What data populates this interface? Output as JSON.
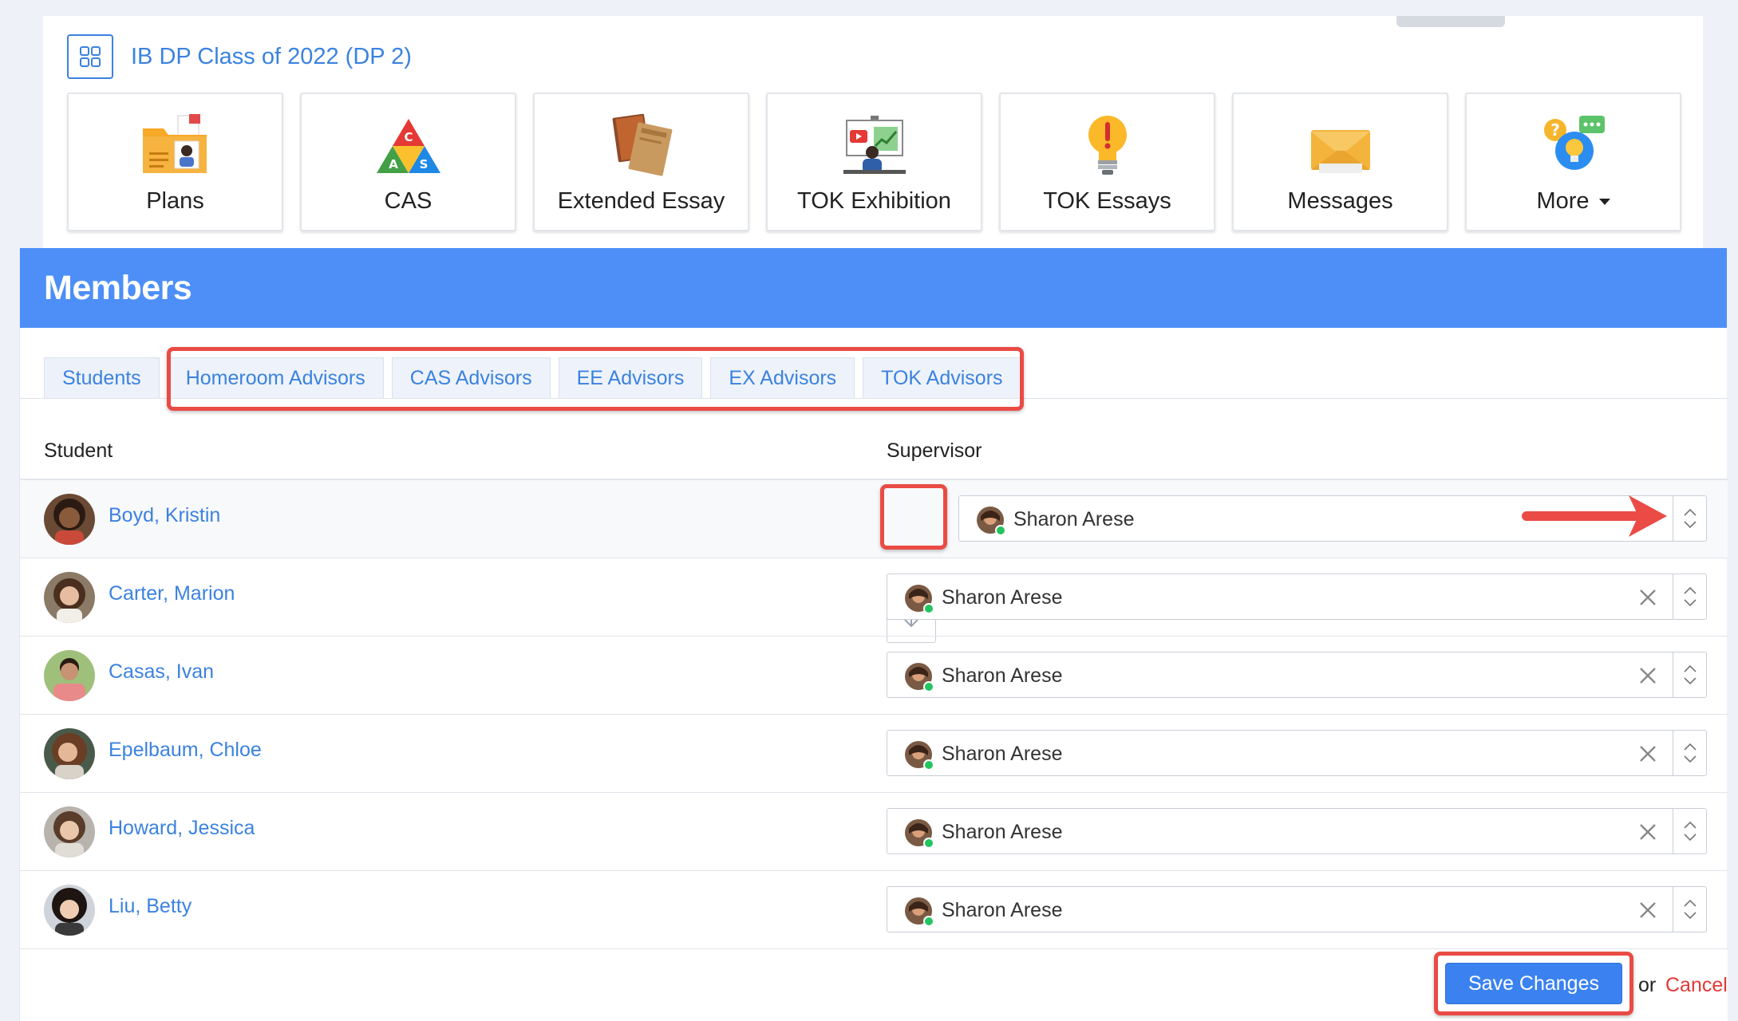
{
  "class_title": "IB DP Class of 2022 (DP 2)",
  "tiles": [
    {
      "label": "Plans",
      "icon": "folder-person-icon"
    },
    {
      "label": "CAS",
      "icon": "cas-triangle-icon"
    },
    {
      "label": "Extended Essay",
      "icon": "books-icon"
    },
    {
      "label": "TOK Exhibition",
      "icon": "presentation-icon"
    },
    {
      "label": "TOK Essays",
      "icon": "lightbulb-icon"
    },
    {
      "label": "Messages",
      "icon": "envelope-icon"
    },
    {
      "label": "More",
      "icon": "help-chat-icon"
    }
  ],
  "members": {
    "title": "Members",
    "tabs": [
      "Students",
      "Homeroom Advisors",
      "CAS Advisors",
      "EE Advisors",
      "EX Advisors",
      "TOK Advisors"
    ],
    "columns": {
      "student": "Student",
      "supervisor": "Supervisor"
    },
    "rows": [
      {
        "student": "Boyd, Kristin",
        "supervisor": "Sharon Arese"
      },
      {
        "student": "Carter, Marion",
        "supervisor": "Sharon Arese"
      },
      {
        "student": "Casas, Ivan",
        "supervisor": "Sharon Arese"
      },
      {
        "student": "Epelbaum, Chloe",
        "supervisor": "Sharon Arese"
      },
      {
        "student": "Howard, Jessica",
        "supervisor": "Sharon Arese"
      },
      {
        "student": "Liu, Betty",
        "supervisor": "Sharon Arese"
      }
    ]
  },
  "footer": {
    "save_label": "Save Changes",
    "or_text": "or",
    "cancel_label": "Cancel"
  },
  "colors": {
    "accent": "#3b82e0",
    "header": "#4d8ff7",
    "highlight": "#ea4b45",
    "cancel": "#e53935",
    "online": "#22c55e"
  }
}
